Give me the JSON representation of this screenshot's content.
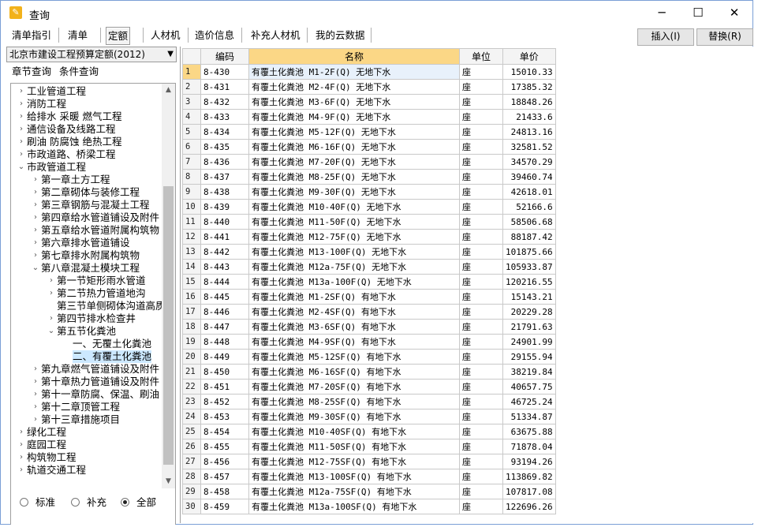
{
  "window": {
    "title": "查询",
    "icon": "app-icon",
    "controls": [
      "minimize",
      "maximize",
      "close"
    ]
  },
  "toolbar": {
    "tabs": [
      "清单指引",
      "清单",
      "定额",
      "人材机",
      "造价信息",
      "补充人材机",
      "我的云数据"
    ],
    "active_tab": "定额",
    "insert_label": "插入(I)",
    "replace_label": "替换(R)"
  },
  "left": {
    "quota_selected": "北京市建设工程预算定额(2012)",
    "subtabs": [
      "章节查询",
      "条件查询"
    ],
    "tree": [
      {
        "label": "工业管道工程",
        "level": 1,
        "exp": "collapsed"
      },
      {
        "label": "消防工程",
        "level": 1,
        "exp": "collapsed"
      },
      {
        "label": "给排水 采暖 燃气工程",
        "level": 1,
        "exp": "collapsed"
      },
      {
        "label": "通信设备及线路工程",
        "level": 1,
        "exp": "collapsed"
      },
      {
        "label": "刷油 防腐蚀 绝热工程",
        "level": 1,
        "exp": "collapsed"
      },
      {
        "label": "市政道路、桥梁工程",
        "level": 1,
        "exp": "collapsed"
      },
      {
        "label": "市政管道工程",
        "level": 1,
        "exp": "expanded"
      },
      {
        "label": "第一章土方工程",
        "level": 2,
        "exp": "collapsed"
      },
      {
        "label": "第二章砌体与装修工程",
        "level": 2,
        "exp": "collapsed"
      },
      {
        "label": "第三章钢筋与混凝土工程",
        "level": 2,
        "exp": "collapsed"
      },
      {
        "label": "第四章给水管道铺设及附件",
        "level": 2,
        "exp": "collapsed"
      },
      {
        "label": "第五章给水管道附属构筑物",
        "level": 2,
        "exp": "collapsed"
      },
      {
        "label": "第六章排水管道铺设",
        "level": 2,
        "exp": "collapsed"
      },
      {
        "label": "第七章排水附属构筑物",
        "level": 2,
        "exp": "collapsed"
      },
      {
        "label": "第八章混凝土模块工程",
        "level": 2,
        "exp": "expanded"
      },
      {
        "label": "第一节矩形雨水管道",
        "level": 3,
        "exp": "collapsed"
      },
      {
        "label": "第二节热力管道地沟",
        "level": 3,
        "exp": "collapsed"
      },
      {
        "label": "第三节单侧砌体沟道高质",
        "level": 3,
        "exp": "none"
      },
      {
        "label": "第四节排水检查井",
        "level": 3,
        "exp": "collapsed"
      },
      {
        "label": "第五节化粪池",
        "level": 3,
        "exp": "expanded"
      },
      {
        "label": "一、无覆土化粪池",
        "level": 4,
        "exp": "none"
      },
      {
        "label": "二、有覆土化粪池",
        "level": 4,
        "exp": "none",
        "selected": true
      },
      {
        "label": "第九章燃气管道铺设及附件",
        "level": 2,
        "exp": "collapsed"
      },
      {
        "label": "第十章热力管道铺设及附件",
        "level": 2,
        "exp": "collapsed"
      },
      {
        "label": "第十一章防腐、保温、刷油",
        "level": 2,
        "exp": "collapsed"
      },
      {
        "label": "第十二章顶管工程",
        "level": 2,
        "exp": "collapsed"
      },
      {
        "label": "第十三章措施项目",
        "level": 2,
        "exp": "collapsed"
      },
      {
        "label": "绿化工程",
        "level": 1,
        "exp": "collapsed"
      },
      {
        "label": "庭园工程",
        "level": 1,
        "exp": "collapsed"
      },
      {
        "label": "构筑物工程",
        "level": 1,
        "exp": "collapsed"
      },
      {
        "label": "轨道交通工程",
        "level": 1,
        "exp": "collapsed"
      }
    ],
    "radio_options": [
      "标准",
      "补充",
      "全部"
    ],
    "radio_selected": "全部"
  },
  "table": {
    "columns": [
      "编码",
      "名称",
      "单位",
      "单价"
    ],
    "highlight_column": "名称",
    "rows": [
      [
        "1",
        "8-430",
        "有覆土化粪池 M1-2F(Q) 无地下水",
        "座",
        "15010.33"
      ],
      [
        "2",
        "8-431",
        "有覆土化粪池 M2-4F(Q) 无地下水",
        "座",
        "17385.32"
      ],
      [
        "3",
        "8-432",
        "有覆土化粪池 M3-6F(Q) 无地下水",
        "座",
        "18848.26"
      ],
      [
        "4",
        "8-433",
        "有覆土化粪池 M4-9F(Q) 无地下水",
        "座",
        "21433.6"
      ],
      [
        "5",
        "8-434",
        "有覆土化粪池 M5-12F(Q) 无地下水",
        "座",
        "24813.16"
      ],
      [
        "6",
        "8-435",
        "有覆土化粪池 M6-16F(Q) 无地下水",
        "座",
        "32581.52"
      ],
      [
        "7",
        "8-436",
        "有覆土化粪池 M7-20F(Q) 无地下水",
        "座",
        "34570.29"
      ],
      [
        "8",
        "8-437",
        "有覆土化粪池 M8-25F(Q) 无地下水",
        "座",
        "39460.74"
      ],
      [
        "9",
        "8-438",
        "有覆土化粪池 M9-30F(Q) 无地下水",
        "座",
        "42618.01"
      ],
      [
        "10",
        "8-439",
        "有覆土化粪池 M10-40F(Q) 无地下水",
        "座",
        "52166.6"
      ],
      [
        "11",
        "8-440",
        "有覆土化粪池 M11-50F(Q) 无地下水",
        "座",
        "58506.68"
      ],
      [
        "12",
        "8-441",
        "有覆土化粪池 M12-75F(Q) 无地下水",
        "座",
        "88187.42"
      ],
      [
        "13",
        "8-442",
        "有覆土化粪池 M13-100F(Q) 无地下水",
        "座",
        "101875.66"
      ],
      [
        "14",
        "8-443",
        "有覆土化粪池 M12a-75F(Q) 无地下水",
        "座",
        "105933.87"
      ],
      [
        "15",
        "8-444",
        "有覆土化粪池 M13a-100F(Q) 无地下水",
        "座",
        "120216.55"
      ],
      [
        "16",
        "8-445",
        "有覆土化粪池 M1-2SF(Q) 有地下水",
        "座",
        "15143.21"
      ],
      [
        "17",
        "8-446",
        "有覆土化粪池 M2-4SF(Q) 有地下水",
        "座",
        "20229.28"
      ],
      [
        "18",
        "8-447",
        "有覆土化粪池 M3-6SF(Q) 有地下水",
        "座",
        "21791.63"
      ],
      [
        "19",
        "8-448",
        "有覆土化粪池 M4-9SF(Q) 有地下水",
        "座",
        "24901.99"
      ],
      [
        "20",
        "8-449",
        "有覆土化粪池 M5-12SF(Q) 有地下水",
        "座",
        "29155.94"
      ],
      [
        "21",
        "8-450",
        "有覆土化粪池 M6-16SF(Q) 有地下水",
        "座",
        "38219.84"
      ],
      [
        "22",
        "8-451",
        "有覆土化粪池 M7-20SF(Q) 有地下水",
        "座",
        "40657.75"
      ],
      [
        "23",
        "8-452",
        "有覆土化粪池 M8-25SF(Q) 有地下水",
        "座",
        "46725.24"
      ],
      [
        "24",
        "8-453",
        "有覆土化粪池 M9-30SF(Q) 有地下水",
        "座",
        "51334.87"
      ],
      [
        "25",
        "8-454",
        "有覆土化粪池 M10-40SF(Q) 有地下水",
        "座",
        "63675.88"
      ],
      [
        "26",
        "8-455",
        "有覆土化粪池 M11-50SF(Q) 有地下水",
        "座",
        "71878.04"
      ],
      [
        "27",
        "8-456",
        "有覆土化粪池 M12-75SF(Q) 有地下水",
        "座",
        "93194.26"
      ],
      [
        "28",
        "8-457",
        "有覆土化粪池 M13-100SF(Q) 有地下水",
        "座",
        "113869.82"
      ],
      [
        "29",
        "8-458",
        "有覆土化粪池 M12a-75SF(Q) 有地下水",
        "座",
        "107817.08"
      ],
      [
        "30",
        "8-459",
        "有覆土化粪池 M13a-100SF(Q) 有地下水",
        "座",
        "122696.26"
      ]
    ],
    "selected_row": 1
  },
  "colors": {
    "selection": "#cce8ff",
    "header_highlight": "#fbd786",
    "window_border": "#7a9fd6"
  }
}
